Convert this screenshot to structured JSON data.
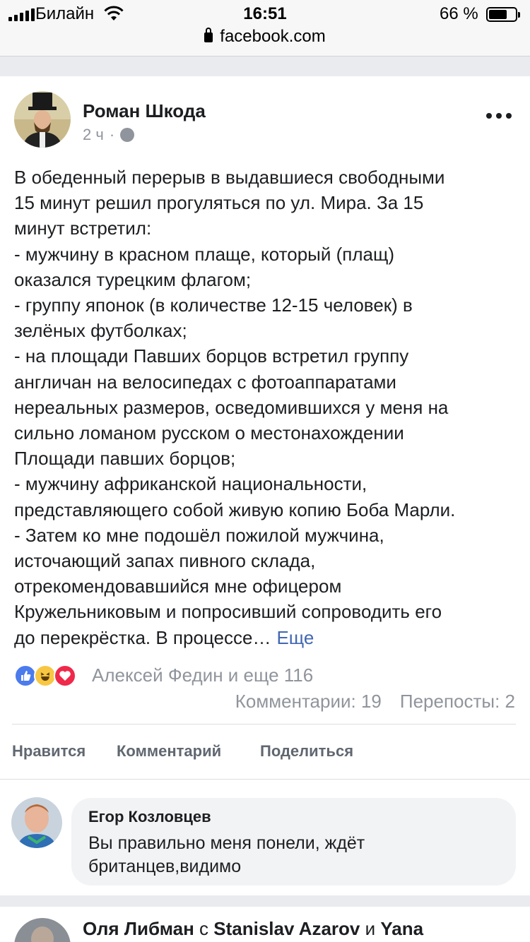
{
  "status_bar": {
    "carrier": "Билайн",
    "time": "16:51",
    "battery": "66 %",
    "battery_level": 0.66
  },
  "browser": {
    "url": "facebook.com"
  },
  "post": {
    "author": "Роман Шкода",
    "time_ago": "2 ч",
    "privacy_icon": "globe-icon",
    "text_lines": [
      "В обеденный перерыв в выдавшиеся свободными",
      "15 минут решил прогуляться по ул. Мира. За 15",
      "минут встретил:",
      "- мужчину в красном плаще, который (плащ)",
      "оказался турецким флагом;",
      "- группу японок (в количестве 12-15 человек) в",
      "зелёных футболках;",
      "- на площади Павших борцов встретил группу",
      "англичан на велосипедах с фотоаппаратами",
      "нереальных размеров, осведомившихся у меня на",
      "сильно ломаном русском о местонахождении",
      "Площади павших борцов;",
      "- мужчину африканской национальности,",
      "представляющего собой живую копию Боба Марли.",
      "- Затем ко мне подошёл пожилой мужчина,",
      "источающий запах пивного склада,",
      "отрекомендовавшийся мне офицером",
      "Кружельниковым и попросивший сопроводить его",
      "до перекрёстка. В процессе…"
    ],
    "see_more": "Еще",
    "reactions": {
      "icons": [
        "like-icon",
        "haha-icon",
        "love-icon"
      ],
      "summary": "Алексей Федин и еще 116"
    },
    "comments_count": "Комментарии: 19",
    "shares_count": "Перепосты: 2",
    "actions": {
      "like": "Нравится",
      "comment": "Комментарий",
      "share": "Поделиться"
    }
  },
  "comment": {
    "author": "Егор Козловцев",
    "text_lines": [
      "Вы правильно меня понели, ждёт",
      "британцев,видимо"
    ]
  },
  "next_post": {
    "author": "Оля Либман",
    "with": "с",
    "tagged_1": "Stanislav Azarov",
    "and": "и",
    "tagged_2": "Yana"
  },
  "colors": {
    "link": "#4267b2",
    "secondary_text": "#90949c",
    "separator": "#e9ebee",
    "like": "#4b7bec",
    "haha": "#f7c744",
    "love": "#f0284a"
  }
}
